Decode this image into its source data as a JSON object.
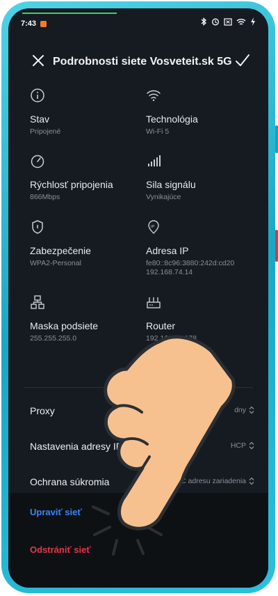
{
  "status": {
    "time": "7:43"
  },
  "header": {
    "title": "Podrobnosti siete Vosveteit.sk 5G"
  },
  "details": [
    {
      "label": "Stav",
      "value": "Pripojené",
      "icon": "info-icon"
    },
    {
      "label": "Technológia",
      "value": "Wi-Fi 5",
      "icon": "wifi-icon"
    },
    {
      "label": "Rýchlosť pripojenia",
      "value": "866Mbps",
      "icon": "speedometer-icon"
    },
    {
      "label": "Sila signálu",
      "value": "Vynikajúce",
      "icon": "signal-icon"
    },
    {
      "label": "Zabezpečenie",
      "value": "WPA2-Personal",
      "icon": "shield-icon"
    },
    {
      "label": "Adresa IP",
      "value": "fe80::8c96:3880:242d:cd20",
      "value2": "192.168.74.14",
      "icon": "ip-pin-icon"
    },
    {
      "label": "Maska podsiete",
      "value": "255.255.255.0",
      "icon": "network-icon"
    },
    {
      "label": "Router",
      "value": "192.168.74.178",
      "icon": "router-icon"
    }
  ],
  "settings": [
    {
      "label": "Proxy",
      "value": "dny"
    },
    {
      "label": "Nastavenia adresy IP",
      "value": "HCP"
    },
    {
      "label": "Ochrana súkromia",
      "value": "C adresu zariadenia"
    }
  ],
  "actions": {
    "edit": "Upraviť sieť",
    "delete": "Odstrániť sieť"
  },
  "colors": {
    "accent_blue": "#3a86f6",
    "danger_red": "#e8354a",
    "background": "#161b21",
    "frame": "#1aa7c4"
  }
}
